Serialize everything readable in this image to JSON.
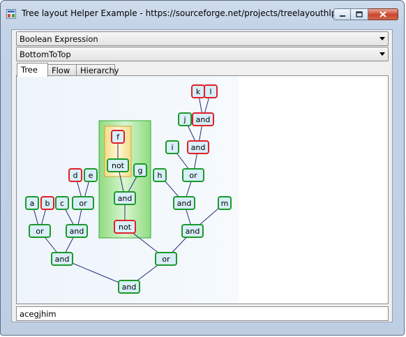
{
  "window": {
    "title": "Tree layout Helper Example - https://sourceforge.net/projects/treelayouthlpr/"
  },
  "combos": {
    "expression": "Boolean Expression",
    "direction": "BottomToTop"
  },
  "tabs": [
    "Tree",
    "Flow",
    "Hierarchy"
  ],
  "active_tab": "Tree",
  "tree": {
    "nodes": [
      {
        "id": "k",
        "label": "k",
        "color": "red"
      },
      {
        "id": "l",
        "label": "l",
        "color": "red"
      },
      {
        "id": "and_kl",
        "label": "and",
        "color": "red"
      },
      {
        "id": "j",
        "label": "j",
        "color": "green"
      },
      {
        "id": "and_j",
        "label": "and",
        "color": "red"
      },
      {
        "id": "i",
        "label": "i",
        "color": "green"
      },
      {
        "id": "or_i",
        "label": "or",
        "color": "green"
      },
      {
        "id": "h",
        "label": "h",
        "color": "green"
      },
      {
        "id": "and_h",
        "label": "and",
        "color": "green"
      },
      {
        "id": "m",
        "label": "m",
        "color": "green"
      },
      {
        "id": "and_m",
        "label": "and",
        "color": "green"
      },
      {
        "id": "f",
        "label": "f",
        "color": "red"
      },
      {
        "id": "not_f",
        "label": "not",
        "color": "green"
      },
      {
        "id": "g",
        "label": "g",
        "color": "green"
      },
      {
        "id": "and_g",
        "label": "and",
        "color": "green"
      },
      {
        "id": "not_top",
        "label": "not",
        "color": "red"
      },
      {
        "id": "d",
        "label": "d",
        "color": "red"
      },
      {
        "id": "e",
        "label": "e",
        "color": "green"
      },
      {
        "id": "or_de",
        "label": "or",
        "color": "green"
      },
      {
        "id": "a",
        "label": "a",
        "color": "green"
      },
      {
        "id": "b",
        "label": "b",
        "color": "red"
      },
      {
        "id": "or_ab",
        "label": "or",
        "color": "green"
      },
      {
        "id": "c",
        "label": "c",
        "color": "green"
      },
      {
        "id": "and_c",
        "label": "and",
        "color": "green"
      },
      {
        "id": "and_left",
        "label": "and",
        "color": "green"
      },
      {
        "id": "or_right",
        "label": "or",
        "color": "green"
      },
      {
        "id": "and_root",
        "label": "and",
        "color": "green"
      }
    ],
    "edges": [
      [
        "k",
        "and_kl"
      ],
      [
        "l",
        "and_kl"
      ],
      [
        "and_kl",
        "and_j"
      ],
      [
        "j",
        "and_j"
      ],
      [
        "and_j",
        "or_i"
      ],
      [
        "i",
        "or_i"
      ],
      [
        "or_i",
        "and_h"
      ],
      [
        "h",
        "and_h"
      ],
      [
        "and_h",
        "and_m"
      ],
      [
        "m",
        "and_m"
      ],
      [
        "f",
        "not_f"
      ],
      [
        "not_f",
        "and_g"
      ],
      [
        "g",
        "and_g"
      ],
      [
        "and_g",
        "not_top"
      ],
      [
        "d",
        "or_de"
      ],
      [
        "e",
        "or_de"
      ],
      [
        "a",
        "or_ab"
      ],
      [
        "b",
        "or_ab"
      ],
      [
        "c",
        "and_c"
      ],
      [
        "or_de",
        "and_c"
      ],
      [
        "or_ab",
        "and_left"
      ],
      [
        "and_c",
        "and_left"
      ],
      [
        "not_top",
        "or_right"
      ],
      [
        "and_m",
        "or_right"
      ],
      [
        "and_left",
        "and_root"
      ],
      [
        "or_right",
        "and_root"
      ]
    ]
  },
  "colors": {
    "red_border": "#e0202a",
    "green_border": "#1a9a2a",
    "node_fill": "#d8eef8",
    "edge": "#1f2a7a",
    "group_fill": "#aee6a0",
    "group_border": "#3aa83a",
    "inner_group_border": "#e0a030"
  },
  "status_text": "acegjhim"
}
